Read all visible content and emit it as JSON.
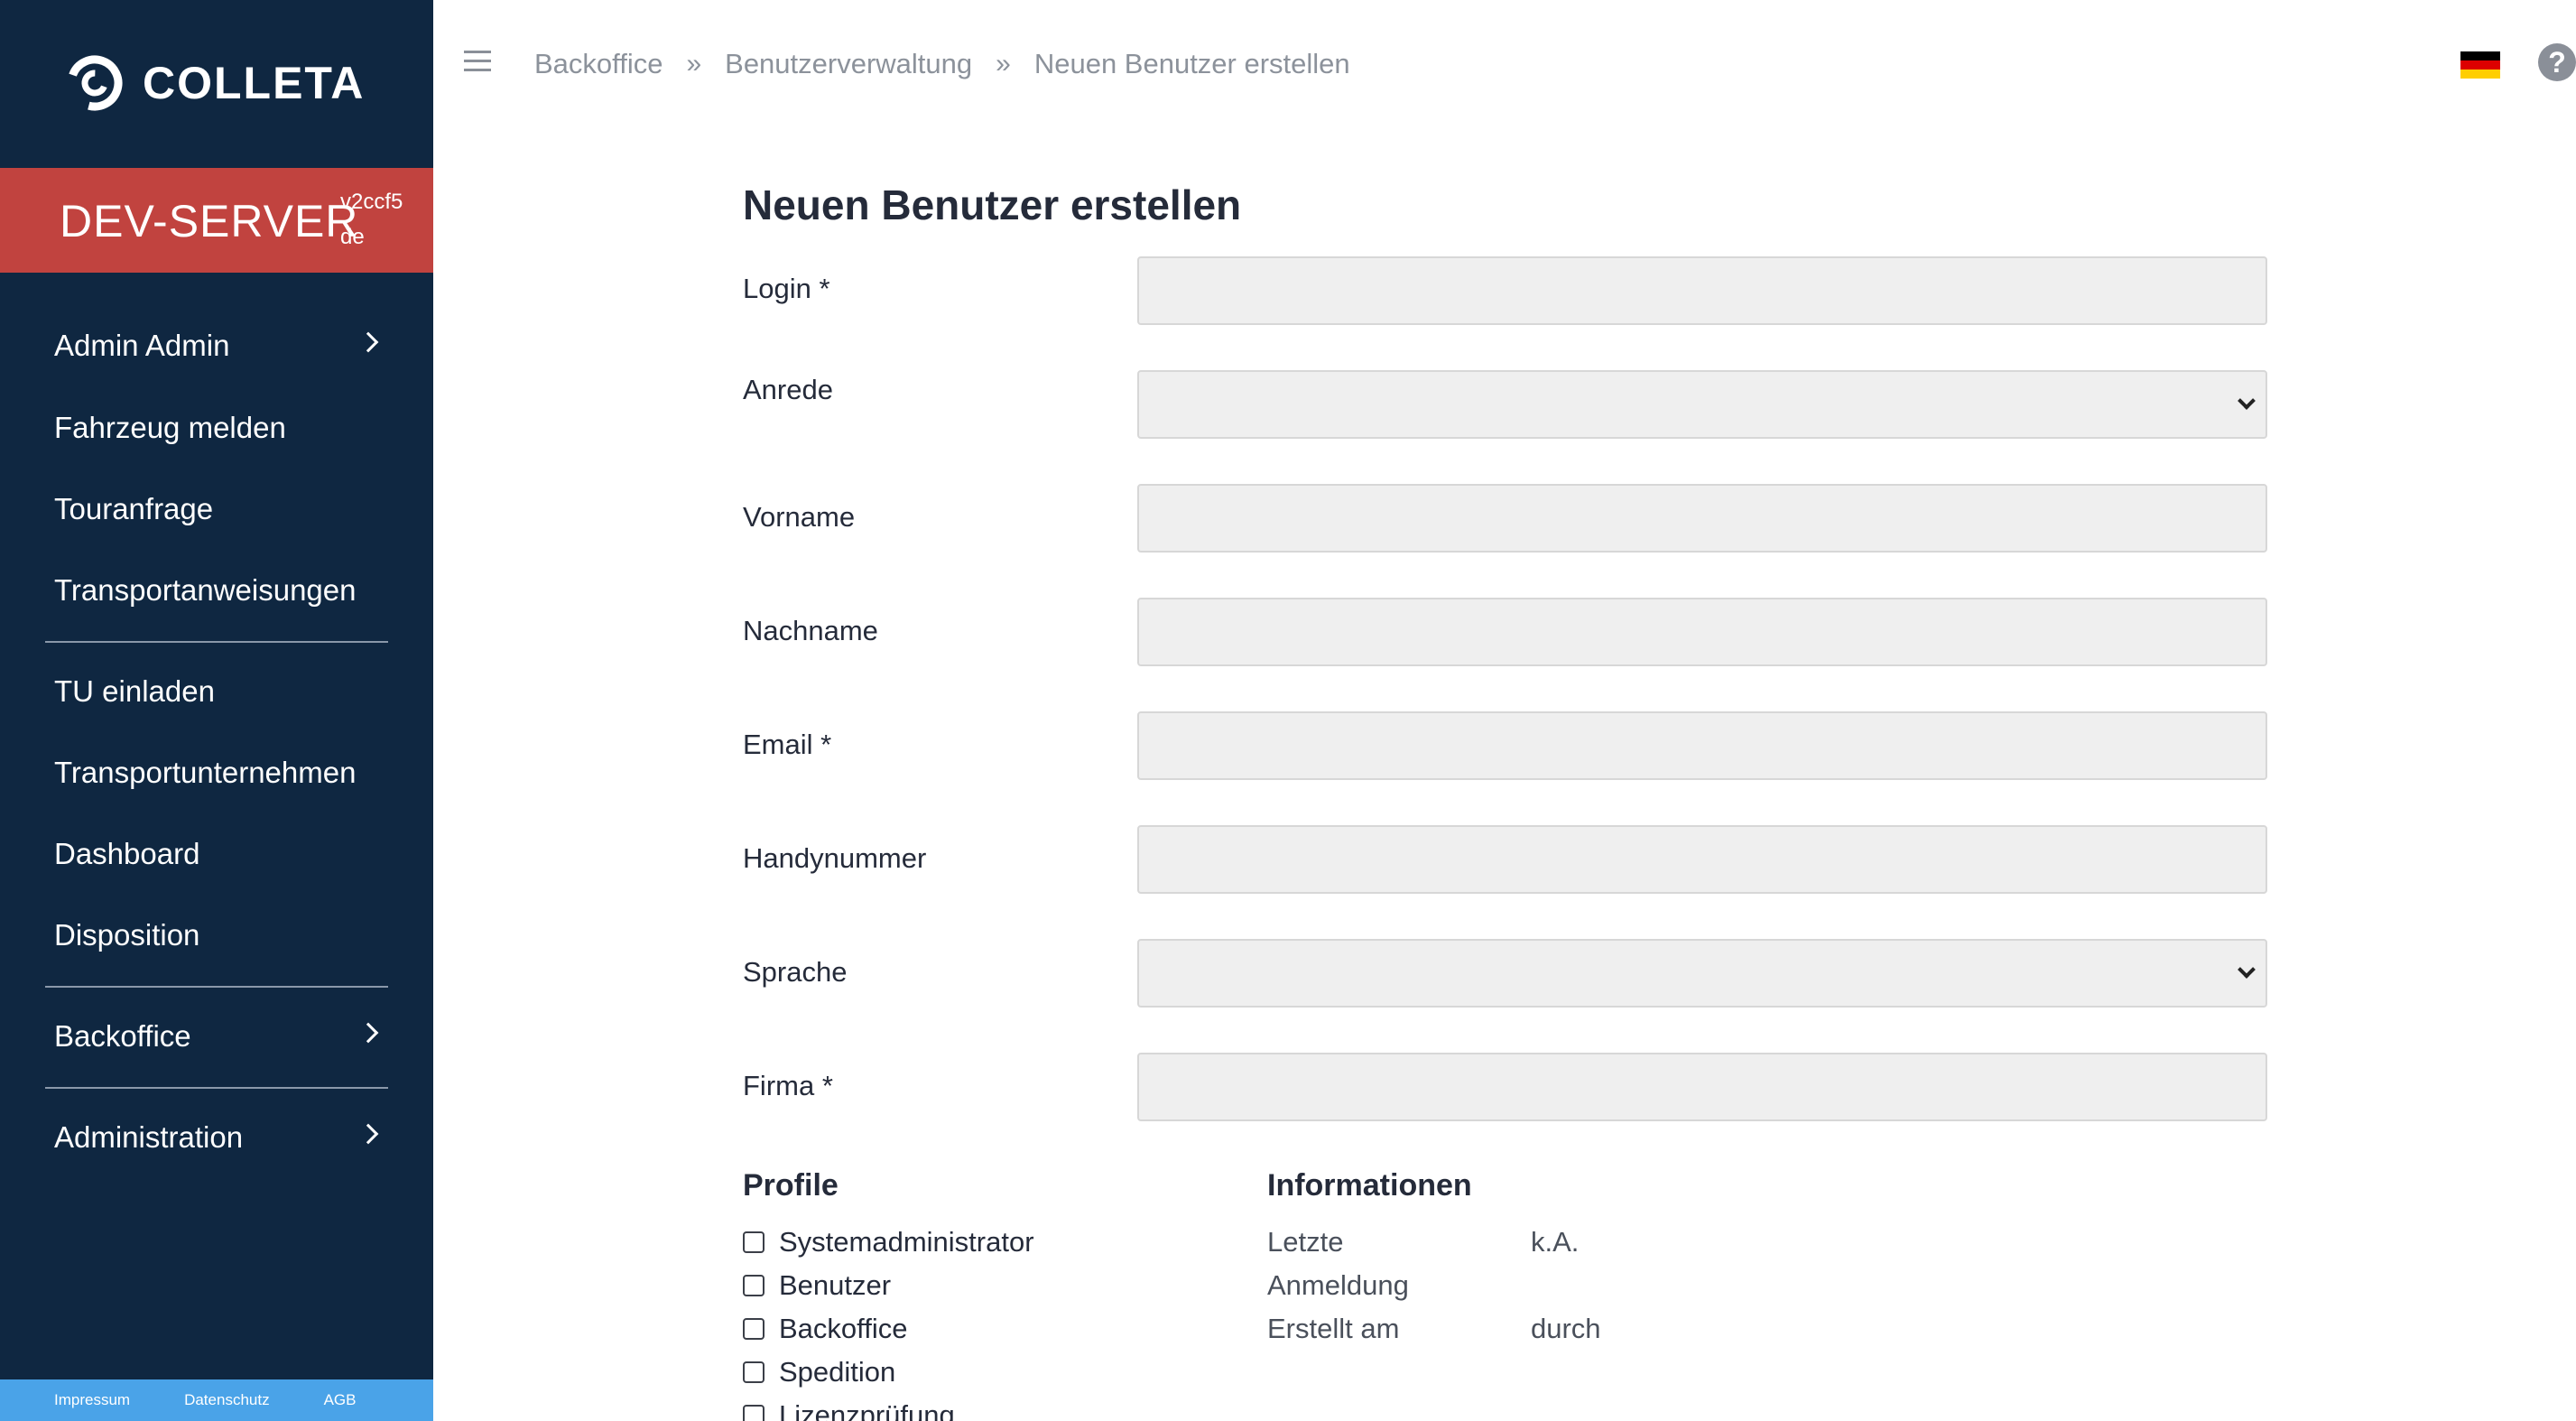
{
  "brand": {
    "name": "COLLETA"
  },
  "environment": {
    "name": "DEV-SERVER",
    "version": "v2ccf5",
    "language": "de"
  },
  "sidebar": {
    "items": [
      {
        "label": "Admin Admin",
        "has_submenu": true
      },
      {
        "label": "Fahrzeug melden"
      },
      {
        "label": "Touranfrage"
      },
      {
        "label": "Transportanweisungen"
      },
      {
        "label": "TU einladen"
      },
      {
        "label": "Transportunternehmen"
      },
      {
        "label": "Dashboard"
      },
      {
        "label": "Disposition"
      },
      {
        "label": "Backoffice",
        "has_submenu": true
      },
      {
        "label": "Administration",
        "has_submenu": true
      }
    ],
    "footer": {
      "impressum": "Impressum",
      "datenschutz": "Datenschutz",
      "agb": "AGB"
    }
  },
  "breadcrumb": [
    "Backoffice",
    "Benutzerverwaltung",
    "Neuen Benutzer erstellen"
  ],
  "header": {
    "language_flag": "germany-flag-icon",
    "help_icon": "?"
  },
  "form": {
    "title": "Neuen Benutzer erstellen",
    "login_label": "Login *",
    "anrede_label": "Anrede",
    "vorname_label": "Vorname",
    "nachname_label": "Nachname",
    "email_label": "Email *",
    "handy_label": "Handynummer",
    "sprache_label": "Sprache",
    "firma_label": "Firma *",
    "values": {
      "login": "",
      "anrede": "",
      "vorname": "",
      "nachname": "",
      "email": "",
      "handy": "",
      "sprache": "",
      "firma": ""
    }
  },
  "profile": {
    "title": "Profile",
    "items": [
      "Systemadministrator",
      "Benutzer",
      "Backoffice",
      "Spedition",
      "Lizenzprüfung"
    ]
  },
  "info": {
    "title": "Informationen",
    "last_login_label_1": "Letzte",
    "last_login_label_2": "Anmeldung",
    "last_login_value": "k.A.",
    "created_label": "Erstellt am",
    "created_by": "durch"
  },
  "colors": {
    "sidebar": "#0f2741",
    "env_banner": "#c1433f",
    "footer": "#4aa3e8",
    "field_bg": "#efefef"
  }
}
